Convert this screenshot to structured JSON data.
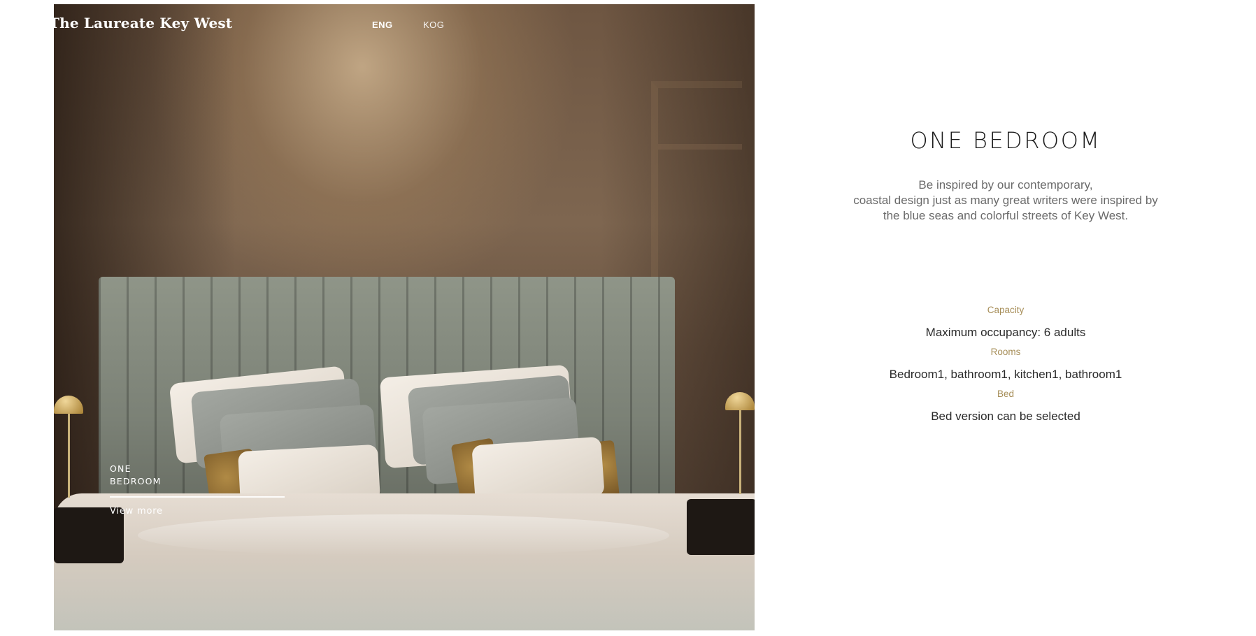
{
  "header": {
    "site_title": "The Laureate Key West",
    "languages": [
      {
        "label": "ENG",
        "active": true
      },
      {
        "label": "KOG",
        "active": false
      }
    ]
  },
  "hero": {
    "caption_line1": "ONE",
    "caption_line2": "BEDROOM",
    "view_more": "View more"
  },
  "room": {
    "title": "ONE BEDROOM",
    "description": [
      "Be inspired by our contemporary,",
      "coastal design just as many great writers were inspired by",
      "the blue seas and colorful streets of Key West."
    ],
    "specs": [
      {
        "label": "Capacity",
        "value": "Maximum occupancy: 6 adults"
      },
      {
        "label": "Rooms",
        "value": "Bedroom1, bathroom1, kitchen1, bathroom1"
      },
      {
        "label": "Bed",
        "value": "Bed version can be selected"
      }
    ]
  },
  "colors": {
    "accent_label": "#a68d57",
    "title_text": "#1c1c1c",
    "body_text": "#6a6a6a"
  }
}
